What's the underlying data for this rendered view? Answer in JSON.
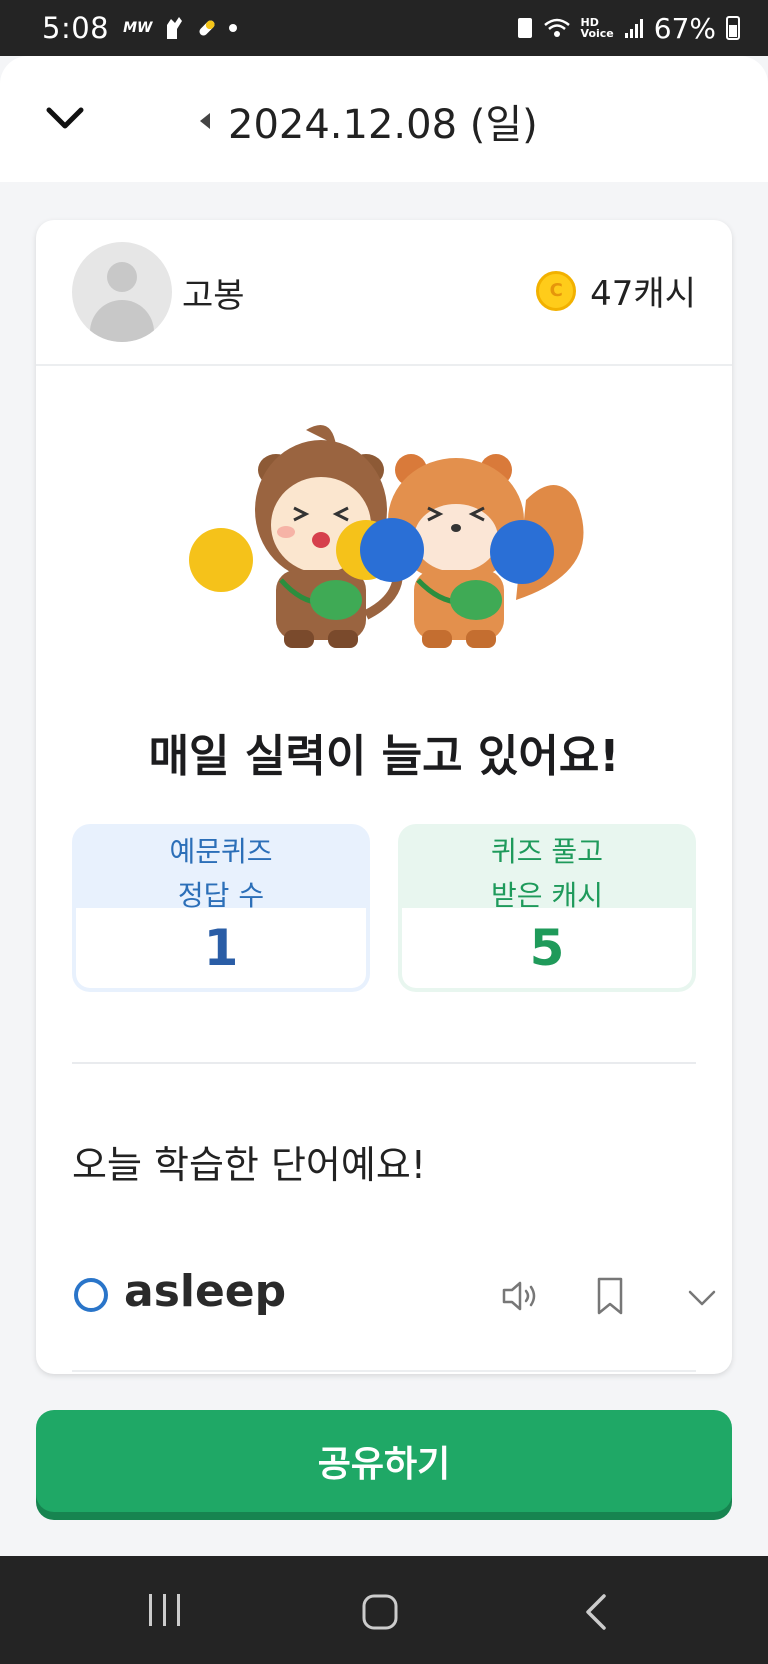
{
  "status_bar": {
    "time": "5:08",
    "icons": [
      "mw-icon",
      "glove-icon",
      "pill-icon",
      "notification-dot"
    ],
    "battery": "67%"
  },
  "header": {
    "date": "2024.12.08 (일)"
  },
  "profile": {
    "username": "고봉",
    "cash": "47캐시"
  },
  "main": {
    "headline": "매일 실력이 늘고 있어요!",
    "stats": [
      {
        "label_line1": "예문퀴즈",
        "label_line2": "정답 수",
        "value": "1",
        "accent": "#2c6fb8"
      },
      {
        "label_line1": "퀴즈 풀고",
        "label_line2": "받은 캐시",
        "value": "5",
        "accent": "#1e9a5b"
      }
    ],
    "section_title": "오늘 학습한 단어예요!",
    "words": [
      {
        "word": "asleep"
      }
    ]
  },
  "share_button": {
    "label": "공유하기",
    "color": "#1fa866"
  }
}
